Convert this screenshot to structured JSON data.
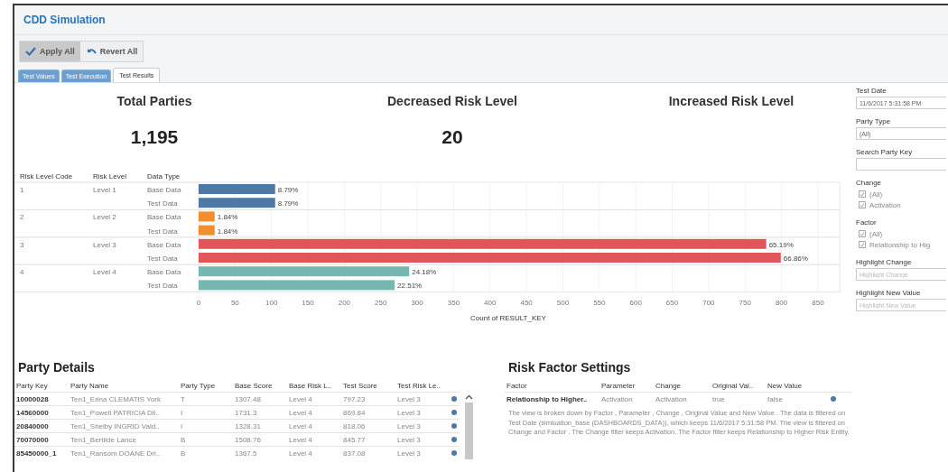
{
  "window": {
    "title": "CDD Simulation"
  },
  "toolbar": [
    {
      "label": "Apply All",
      "kind": "apply",
      "pressed": true
    },
    {
      "label": "Revert All",
      "kind": "revert",
      "pressed": false
    }
  ],
  "tabs": [
    {
      "label": "Test Values",
      "selected": false
    },
    {
      "label": "Test Execution",
      "selected": false
    },
    {
      "label": "Test Results",
      "selected": true
    }
  ],
  "kpis": [
    {
      "title": "Total Parties",
      "value": "1,195"
    },
    {
      "title": "Decreased Risk Level",
      "value": "20"
    },
    {
      "title": "Increased Risk Level"
    }
  ],
  "risk_chart": {
    "columns": [
      "Risk Level Code",
      "Risk Level",
      "Data Type"
    ],
    "groups": [
      {
        "code": "1",
        "level": "Level 1",
        "color": "#4e79a7",
        "percent_labels": [
          "8.79%",
          "8.79%"
        ]
      },
      {
        "code": "2",
        "level": "Level 2",
        "color": "#f28e2b",
        "percent_labels": [
          "1.84%",
          "1.84%"
        ]
      },
      {
        "code": "3",
        "level": "Level 3",
        "color": "#e15759",
        "percent_labels": [
          "65.19%",
          "66.86%"
        ]
      },
      {
        "code": "4",
        "level": "Level 4",
        "color": "#76b7b2",
        "percent_labels": [
          "24.18%",
          "22.51%"
        ]
      }
    ],
    "chart_data": {
      "type": "bar",
      "orientation": "horizontal",
      "xlabel": "Count of RESULT_KEY",
      "categories": [
        "Base Data",
        "Test Data",
        "Base Data",
        "Test Data",
        "Base Data",
        "Test Data",
        "Base Data",
        "Test Data"
      ],
      "values": [
        105,
        105,
        22,
        22,
        779,
        799,
        289,
        269
      ],
      "grid": true,
      "xlim": [
        0,
        880
      ],
      "xticks": [
        0,
        50,
        100,
        150,
        200,
        250,
        300,
        350,
        400,
        450,
        500,
        550,
        600,
        650,
        700,
        750,
        800,
        850
      ]
    }
  },
  "party_details": {
    "title": "Party Details",
    "columns": [
      "Party Key",
      "Party Name",
      "Party Type",
      "Base Score",
      "Base Risk L..",
      "Test Score",
      "Test Risk Le.."
    ],
    "rows": [
      [
        "10000028",
        "Ten1_Erina CLEMATIS York",
        "T",
        "1307.48",
        "Level 4",
        "797.23",
        "Level 3"
      ],
      [
        "14560000",
        "Ten1_Powell PATRICIA Dil..",
        "I",
        "1731.3",
        "Level 4",
        "869.84",
        "Level 3"
      ],
      [
        "20840000",
        "Ten1_Shelby INGRID Vald..",
        "I",
        "1328.31",
        "Level 4",
        "818.06",
        "Level 3"
      ],
      [
        "70070000",
        "Ten1_Bertilde  Lance",
        "B",
        "1508.76",
        "Level 4",
        "845.77",
        "Level 3"
      ],
      [
        "85450000_1",
        "Ten1_Ransom DOANE Dri..",
        "B",
        "1367.5",
        "Level 4",
        "837.08",
        "Level 3"
      ]
    ]
  },
  "risk_factor_settings": {
    "title": "Risk Factor Settings",
    "columns": [
      "Factor",
      "Parameter",
      "Change",
      "Original Val..",
      "New Value"
    ],
    "rows": [
      [
        "Relationship to Higher..",
        "Activation",
        "Activation",
        "true",
        "false"
      ]
    ],
    "description": "The view is broken down by Factor , Parameter , Change , Original Value  and New Value . The data is filtered on Test Date (simluation_base (DASHBOARDS_DATA)), which keeps 11/6/2017 5:31:58 PM. The view is filtered on Change  and Factor . The Change  filter keeps Activation. The Factor  filter keeps Relationship to Higher Risk Entity."
  },
  "filters": [
    {
      "kind": "select",
      "label": "Test Date",
      "value": "11/6/2017 5:31:58 PM"
    },
    {
      "kind": "select",
      "label": "Party Type",
      "value": "(All)"
    },
    {
      "kind": "search",
      "label": "Search Party Key"
    },
    {
      "kind": "checklist",
      "label": "Change",
      "options": [
        {
          "label": "(All)",
          "checked": true
        },
        {
          "label": "Activation",
          "checked": true
        }
      ]
    },
    {
      "kind": "checklist",
      "label": "Factor",
      "options": [
        {
          "label": "(All)",
          "checked": true
        },
        {
          "label": "Relationship to Hig",
          "checked": true
        }
      ]
    },
    {
      "kind": "param",
      "label": "Highlight Change",
      "placeholder": "Highlight Change"
    },
    {
      "kind": "param",
      "label": "Highlight New Value",
      "placeholder": "Highlight New Value"
    }
  ]
}
